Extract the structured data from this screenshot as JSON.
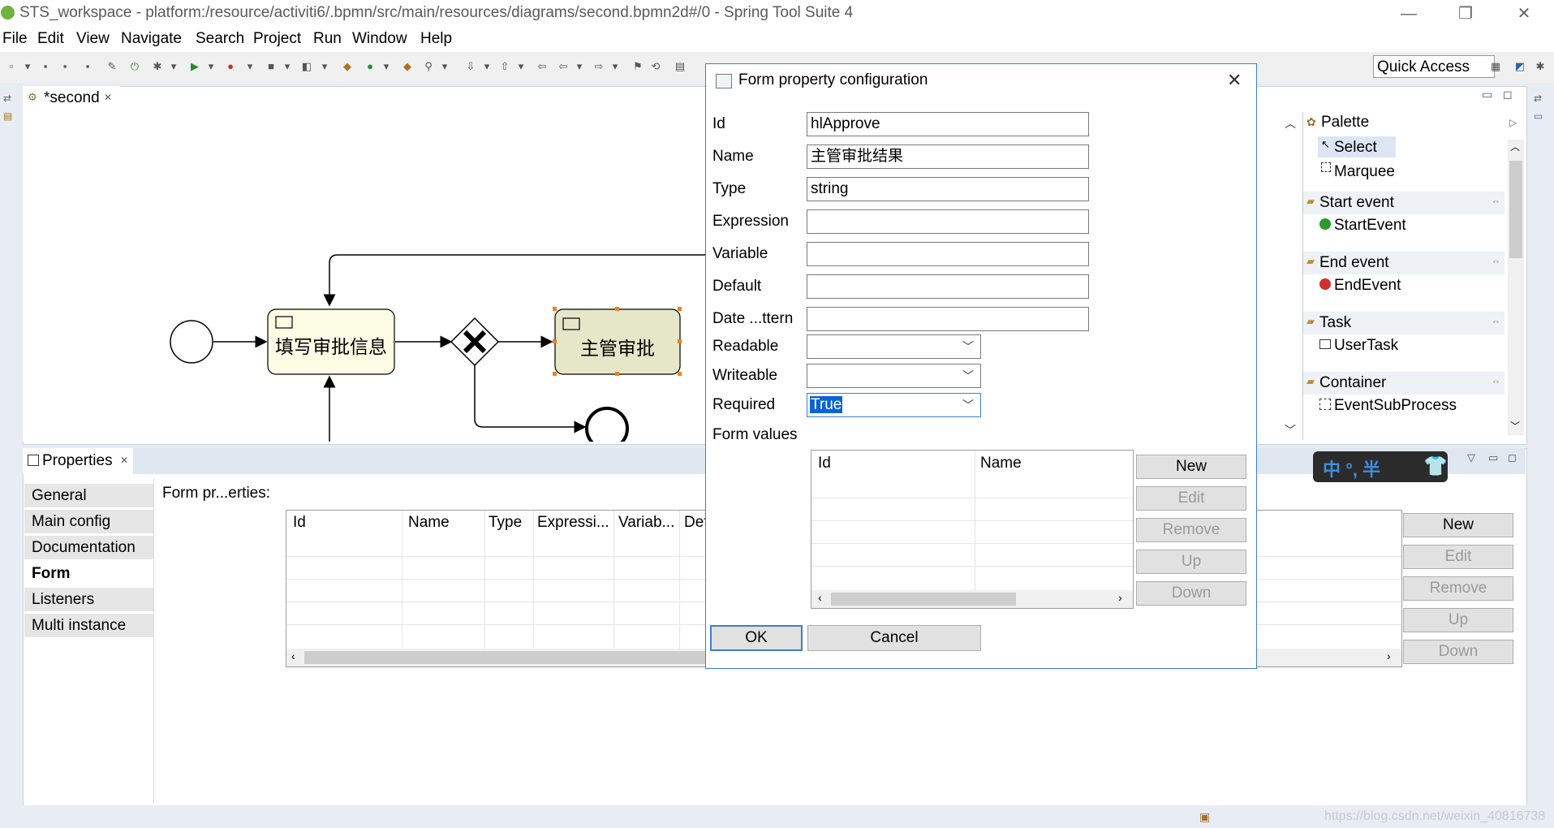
{
  "window": {
    "title": "STS_workspace - platform:/resource/activiti6/.bpmn/src/main/resources/diagrams/second.bpmn2d#/0 - Spring Tool Suite 4",
    "minimize_glyph": "—",
    "restore_glyph": "❐",
    "close_glyph": "✕"
  },
  "menu": [
    "File",
    "Edit",
    "View",
    "Navigate",
    "Search",
    "Project",
    "Run",
    "Window",
    "Help"
  ],
  "toolbar": {
    "quick_access": "Quick Access"
  },
  "editor": {
    "tab_label": "*second",
    "tab_close": "✕",
    "diagram": {
      "task1_label": "填写审批信息",
      "task2_label": "主管审批"
    }
  },
  "palette": {
    "title": "Palette",
    "tools": [
      "Select",
      "Marquee"
    ],
    "groups": [
      {
        "name": "Start event",
        "first_item": "StartEvent"
      },
      {
        "name": "End event",
        "first_item": "EndEvent"
      },
      {
        "name": "Task",
        "first_item": "UserTask"
      },
      {
        "name": "Container",
        "first_item": "EventSubProcess"
      }
    ]
  },
  "properties": {
    "tab_label": "Properties",
    "tab_close": "✕",
    "side_tabs": [
      "General",
      "Main config",
      "Documentation",
      "Form",
      "Listeners",
      "Multi instance"
    ],
    "active_side_tab": "Form",
    "section_label": "Form pr...erties:",
    "table_columns": [
      "Id",
      "Name",
      "Type",
      "Expressi...",
      "Variab...",
      "Def"
    ],
    "buttons": [
      "New",
      "Edit",
      "Remove",
      "Up",
      "Down"
    ]
  },
  "dialog": {
    "title": "Form property configuration",
    "close_glyph": "✕",
    "fields": {
      "id_label": "Id",
      "id_value": "hlApprove",
      "name_label": "Name",
      "name_value": "主管审批结果",
      "type_label": "Type",
      "type_value": "string",
      "expression_label": "Expression",
      "expression_value": "",
      "variable_label": "Variable",
      "variable_value": "",
      "default_label": "Default",
      "default_value": "",
      "date_pattern_label": "Date ...ttern",
      "date_pattern_value": "",
      "readable_label": "Readable",
      "readable_value": "",
      "writeable_label": "Writeable",
      "writeable_value": "",
      "required_label": "Required",
      "required_value": "True"
    },
    "form_values_label": "Form values",
    "form_values_columns": [
      "Id",
      "Name"
    ],
    "side_buttons": [
      "New",
      "Edit",
      "Remove",
      "Up",
      "Down"
    ],
    "ok_label": "OK",
    "cancel_label": "Cancel"
  },
  "ime": {
    "text": "中 °, 半"
  },
  "watermark": "https://blog.csdn.net/weixin_40816738"
}
